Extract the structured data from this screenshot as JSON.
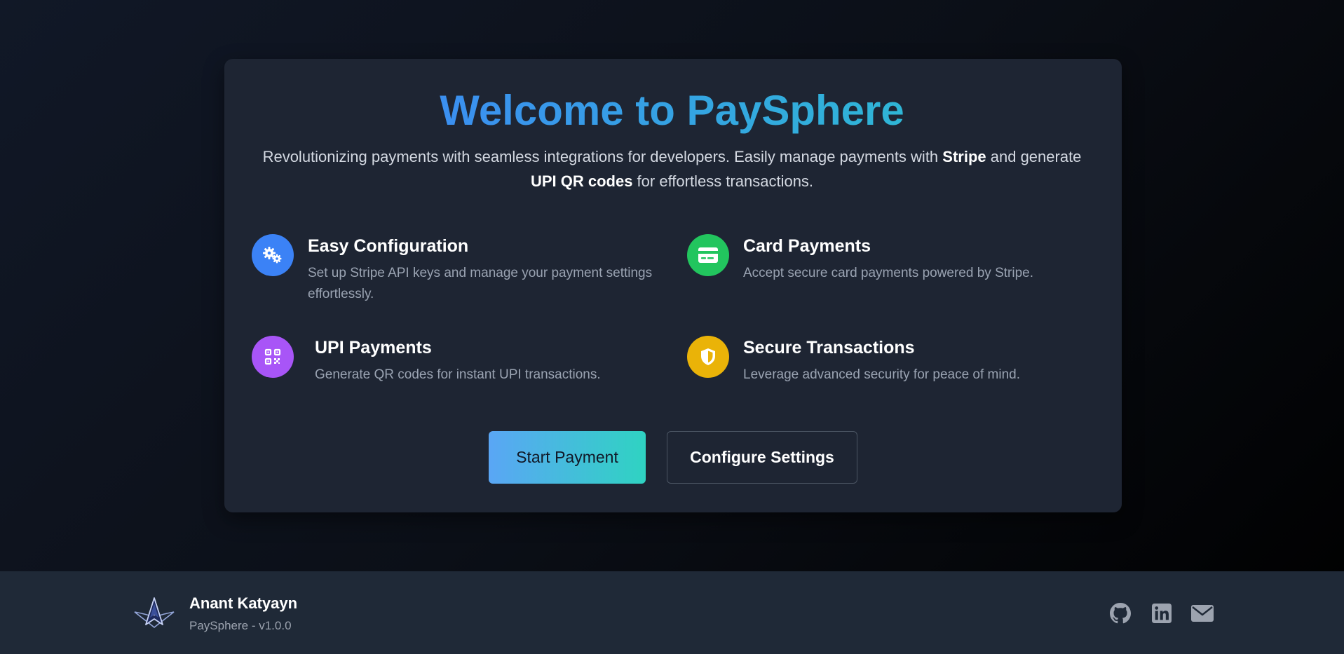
{
  "hero": {
    "title": "Welcome to PaySphere",
    "subtitle_part1": "Revolutionizing payments with seamless integrations for developers. Easily manage payments with ",
    "subtitle_bold1": "Stripe",
    "subtitle_part2": " and generate ",
    "subtitle_bold2": "UPI QR codes",
    "subtitle_part3": " for effortless transactions."
  },
  "features": [
    {
      "title": "Easy Configuration",
      "description": "Set up Stripe API keys and manage your payment settings effortlessly.",
      "icon": "gears-icon",
      "color": "#3b82f6"
    },
    {
      "title": "Card Payments",
      "description": "Accept secure card payments powered by Stripe.",
      "icon": "credit-card-icon",
      "color": "#22c55e"
    },
    {
      "title": "UPI Payments",
      "description": "Generate QR codes for instant UPI transactions.",
      "icon": "qr-code-icon",
      "color": "#a855f7"
    },
    {
      "title": "Secure Transactions",
      "description": "Leverage advanced security for peace of mind.",
      "icon": "shield-icon",
      "color": "#eab308"
    }
  ],
  "actions": {
    "primary_label": "Start Payment",
    "secondary_label": "Configure Settings"
  },
  "footer": {
    "author": "Anant Katyayn",
    "version": "PaySphere - v1.0.0",
    "links": [
      "github-icon",
      "linkedin-icon",
      "mail-icon"
    ]
  },
  "colors": {
    "title_gradient_start": "#3b8ff0",
    "title_gradient_end": "#2fb6d6",
    "card_bg": "#1e2533",
    "footer_bg": "#1f2937"
  }
}
